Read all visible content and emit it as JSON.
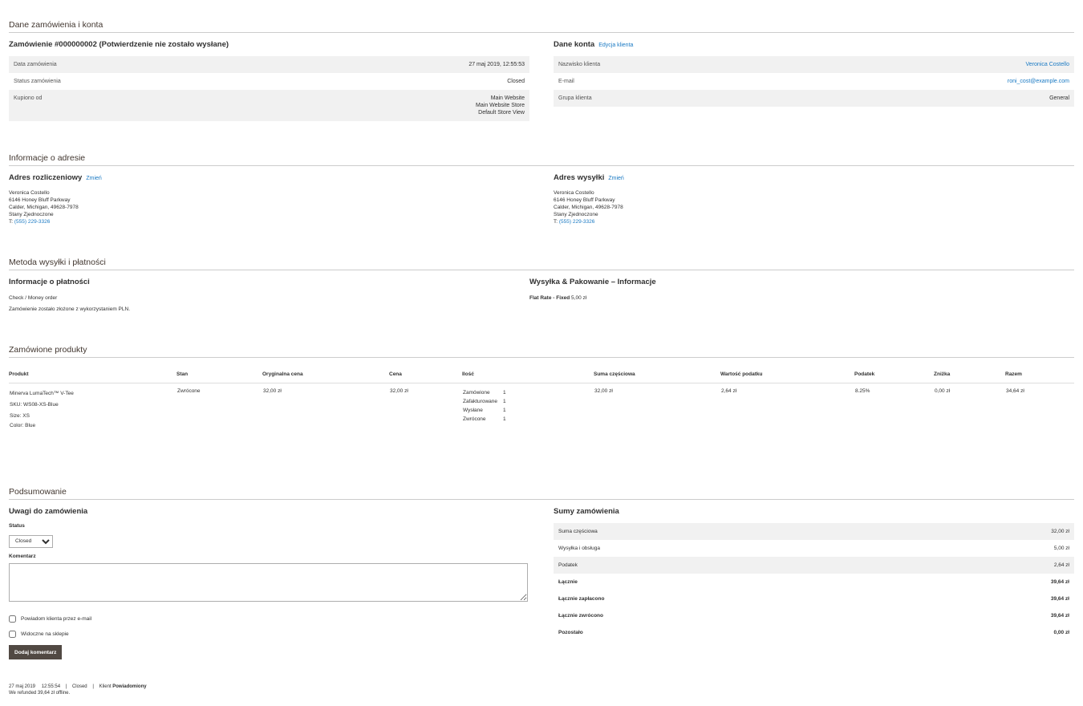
{
  "section1": {
    "title": "Dane zamówienia i konta",
    "order_heading": "Zamówienie #000000002 (Potwierdzenie nie zostało wysłane)",
    "order_rows": [
      {
        "label": "Data zamówienia",
        "value": "27 maj 2019, 12:55:53"
      },
      {
        "label": "Status zamówienia",
        "value": "Closed"
      },
      {
        "label": "Kupiono od",
        "value_lines": [
          "Main Website",
          "Main Website Store",
          "Default Store View"
        ]
      }
    ],
    "account_heading": "Dane konta",
    "account_edit": "Edycja klienta",
    "account_rows": [
      {
        "label": "Nazwisko klienta",
        "value": "Veronica Costello"
      },
      {
        "label": "E-mail",
        "value": "roni_cost@example.com"
      },
      {
        "label": "Grupa klienta",
        "value": "General"
      }
    ]
  },
  "section2": {
    "title": "Informacje o adresie",
    "billing": {
      "heading": "Adres rozliczeniowy",
      "edit": "Zmień",
      "lines": [
        "Veronica Costello",
        "6146 Honey Bluff Parkway",
        "Calder, Michigan, 49628-7978",
        "Stany Zjednoczone"
      ],
      "phone_prefix": "T: ",
      "phone": "(555) 229-3326"
    },
    "shipping": {
      "heading": "Adres wysyłki",
      "edit": "Zmień",
      "lines": [
        "Veronica Costello",
        "6146 Honey Bluff Parkway",
        "Calder, Michigan, 49628-7978",
        "Stany Zjednoczone"
      ],
      "phone_prefix": "T: ",
      "phone": "(555) 229-3326"
    }
  },
  "section3": {
    "title": "Metoda wysyłki i płatności",
    "payment_heading": "Informacje o płatności",
    "payment_method": "Check / Money order",
    "payment_note": "Zamówienie zostało złożone z wykorzystaniem PLN.",
    "shipping_heading": "Wysyłka & Pakowanie – Informacje",
    "shipping_method": "Flat Rate - Fixed",
    "shipping_price": "5,00 zł"
  },
  "section4": {
    "title": "Zamówione produkty",
    "columns": [
      "Produkt",
      "Stan",
      "Oryginalna cena",
      "Cena",
      "Ilość",
      "Suma częściowa",
      "Wartość podatku",
      "Podatek",
      "Zniżka",
      "Razem"
    ],
    "item": {
      "name": "Minerva LumaTech™ V-Tee",
      "sku": "SKU: WS08-XS-Blue",
      "size_label": "Size:",
      "size": "XS",
      "color_label": "Color:",
      "color": "Blue",
      "status": "Zwrócone",
      "original_price": "32,00 zł",
      "price": "32,00 zł",
      "qty": [
        {
          "label": "Zamówione",
          "value": "1"
        },
        {
          "label": "Zafakturowane",
          "value": "1"
        },
        {
          "label": "Wysłane",
          "value": "1"
        },
        {
          "label": "Zwrócone",
          "value": "1"
        }
      ],
      "subtotal": "32,00 zł",
      "tax_amount": "2,64 zł",
      "tax_percent": "8.25%",
      "discount": "0,00 zł",
      "row_total": "34,64 zł"
    }
  },
  "section5": {
    "title": "Podsumowanie",
    "notes_heading": "Uwagi do zamówienia",
    "status_label": "Status",
    "status_value": "Closed",
    "comment_label": "Komentarz",
    "notify_label": "Powiadom klienta przez e-mail",
    "visible_label": "Widoczne na sklepie",
    "submit_label": "Dodaj komentarz",
    "history": {
      "date": "27 maj 2019",
      "time": "12:55:54",
      "status": "Closed",
      "customer_label": "Klient",
      "customer_status": "Powiadomiony",
      "note": "We refunded 39,64 zł offline."
    },
    "totals_heading": "Sumy zamówienia",
    "totals": [
      {
        "label": "Suma częściowa",
        "value": "32,00 zł"
      },
      {
        "label": "Wysyłka i obsługa",
        "value": "5,00 zł"
      },
      {
        "label": "Podatek",
        "value": "2,64 zł"
      },
      {
        "label": "Łącznie",
        "value": "39,64 zł"
      },
      {
        "label": "Łącznie zapłacono",
        "value": "39,64 zł"
      },
      {
        "label": "Łącznie zwrócono",
        "value": "39,64 zł"
      },
      {
        "label": "Pozostało",
        "value": "0,00 zł"
      }
    ]
  }
}
